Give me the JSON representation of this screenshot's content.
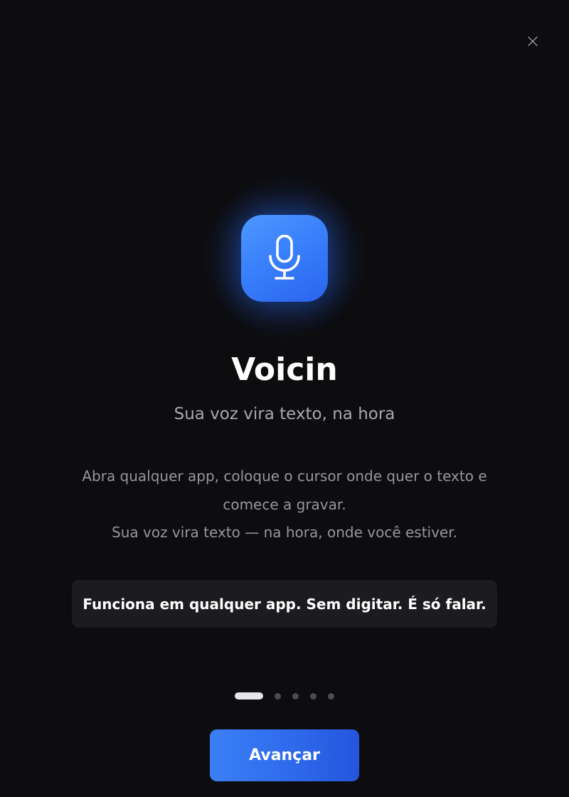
{
  "app": {
    "name": "Voicin",
    "tagline": "Sua voz vira texto, na hora",
    "icon": "microphone-icon",
    "accent_color": "#3a80fb"
  },
  "description": {
    "lines": [
      "Abra qualquer app, coloque o cursor onde quer o texto e",
      "comece a gravar.",
      "Sua voz vira texto — na hora, onde você estiver."
    ]
  },
  "highlight": {
    "text": "Funciona em qualquer app. Sem digitar. É só falar."
  },
  "pagination": {
    "current": 1,
    "total": 5
  },
  "actions": {
    "next_label": "Avançar",
    "close_icon": "close-icon"
  }
}
